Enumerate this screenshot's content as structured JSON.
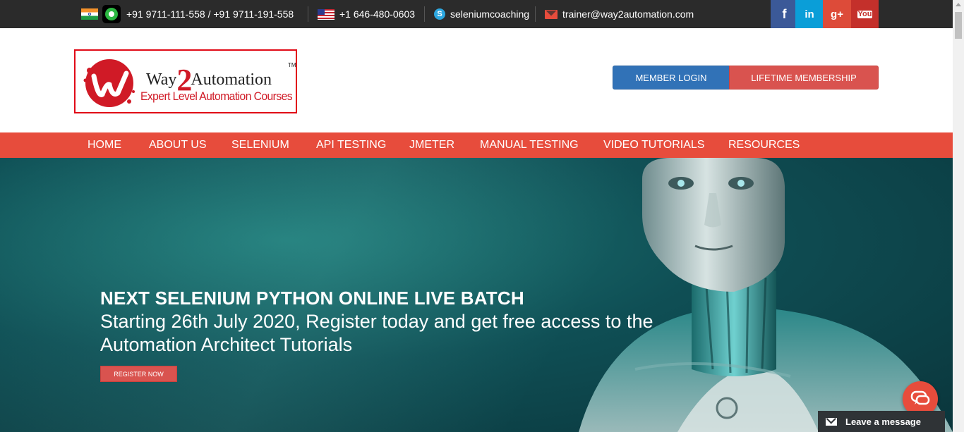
{
  "topbar": {
    "india_phone": "+91 9711-111-558 / +91 9711-191-558",
    "us_phone": "+1 646-480-0603",
    "skype": "seleniumcoaching",
    "email": "trainer@way2automation.com",
    "social": {
      "facebook": "f",
      "linkedin": "in",
      "googleplus": "g+",
      "youtube": "You"
    },
    "icons": [
      "india-flag-icon",
      "whatsapp-icon",
      "us-flag-icon",
      "skype-icon",
      "mail-icon"
    ]
  },
  "logo": {
    "brand_prefix": "Way",
    "brand_two": "2",
    "brand_suffix": "Automation",
    "trademark": "TM",
    "tagline": "Expert Level Automation Courses"
  },
  "header": {
    "member_login": "MEMBER LOGIN",
    "lifetime_membership": "LIFETIME MEMBERSHIP"
  },
  "nav": {
    "items": [
      "HOME",
      "ABOUT US",
      "SELENIUM",
      "API TESTING",
      "JMETER",
      "MANUAL TESTING",
      "VIDEO TUTORIALS",
      "RESOURCES"
    ]
  },
  "hero": {
    "title": "NEXT SELENIUM PYTHON ONLINE LIVE BATCH",
    "subtitle": "Starting 26th July 2020, Register today and get free access to the Automation Architect Tutorials",
    "button": "REGISTER NOW"
  },
  "chat": {
    "leave_message": "Leave a message"
  },
  "colors": {
    "accent_red": "#e74c3c",
    "member_blue": "#3172b7",
    "topbar_bg": "#2b2b2b",
    "hero_teal": "#0f4f55"
  }
}
